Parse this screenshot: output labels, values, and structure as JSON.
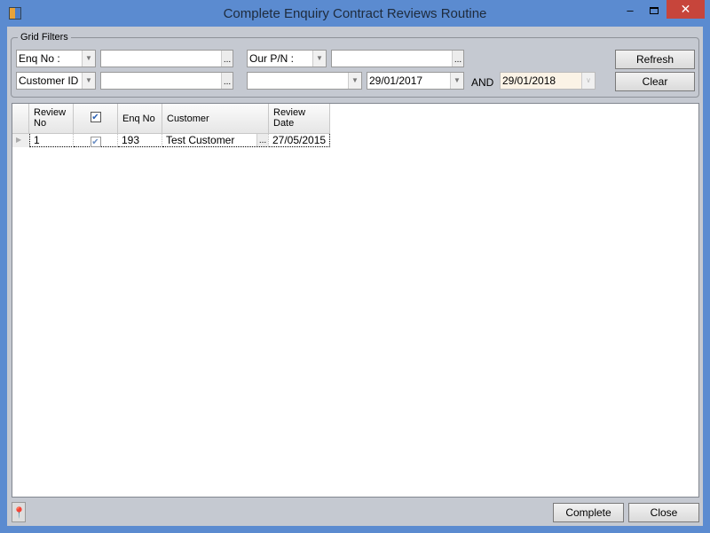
{
  "window": {
    "title": "Complete Enquiry Contract Reviews Routine",
    "minimize": "–",
    "close": "✕"
  },
  "filters": {
    "group_label": "Grid Filters",
    "filter1_field": "Enq No :",
    "filter1_value": "",
    "filter2_field": "Customer ID :",
    "filter2_value": "",
    "filter3_field": "Our P/N :",
    "filter3_value": "",
    "date_field": "",
    "date_from": "29/01/2017",
    "and_label": "AND",
    "date_to": "29/01/2018",
    "refresh": "Refresh",
    "clear": "Clear",
    "ellipsis": "..."
  },
  "grid": {
    "columns": [
      "Review\nNo",
      "",
      "Enq No",
      "Customer",
      "Review\nDate"
    ],
    "col_review_no": "Review No",
    "col_enq": "Enq No",
    "col_customer": "Customer",
    "col_date": "Review Date",
    "rows": [
      {
        "review_no": "1",
        "checked": true,
        "enq_no": "193",
        "customer": "Test Customer",
        "review_date": "27/05/2015"
      }
    ]
  },
  "footer": {
    "complete": "Complete",
    "close": "Close"
  }
}
